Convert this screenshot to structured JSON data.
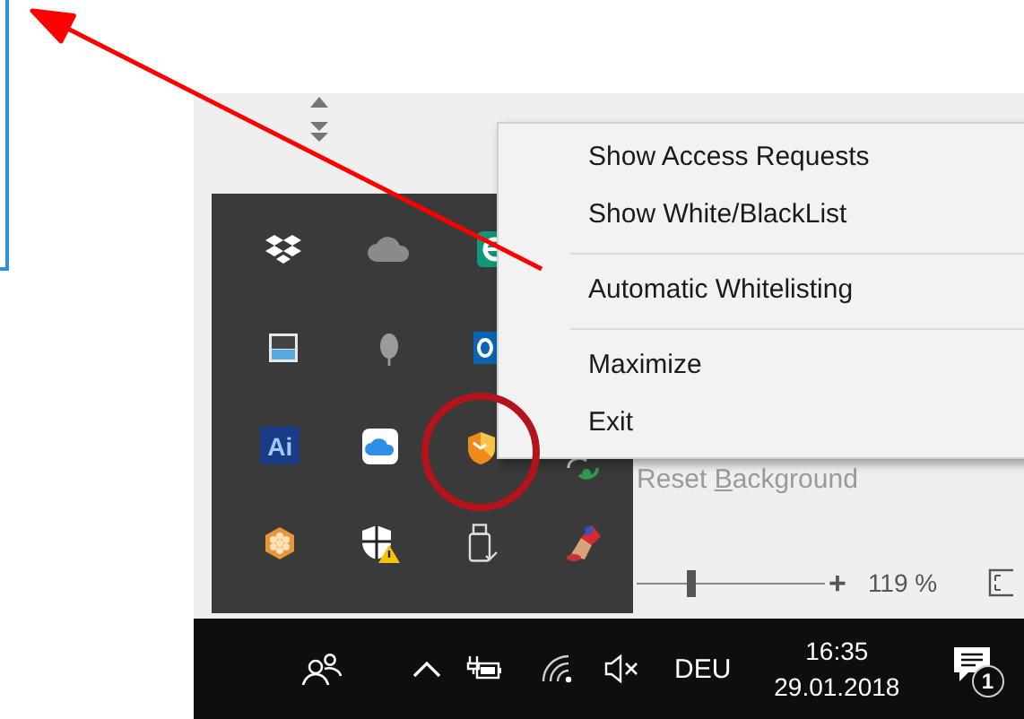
{
  "app": {
    "reset_button": {
      "label_parts": [
        {
          "text": "Reset ",
          "underlined": false
        },
        {
          "text": "B",
          "underlined": true
        },
        {
          "text": "ackground",
          "underlined": false
        }
      ]
    },
    "zoom": {
      "level": 0.29,
      "plus": "+",
      "percent": "119 %"
    }
  },
  "tray_overflow": {
    "rows": [
      [
        {
          "kind": "boxes"
        },
        {
          "kind": "cloud"
        },
        {
          "kind": "green_tile"
        }
      ],
      [
        {
          "kind": "window"
        },
        {
          "kind": "bug"
        },
        {
          "kind": "mail"
        }
      ],
      [
        {
          "kind": "tile",
          "label": "Ai"
        },
        {
          "kind": "cloud_tile"
        },
        {
          "kind": "shield"
        },
        {
          "kind": "sync"
        }
      ],
      [
        {
          "kind": "flower"
        },
        {
          "kind": "shield_warning"
        },
        {
          "kind": "usb"
        },
        {
          "kind": "paint"
        }
      ]
    ]
  },
  "context_menu": {
    "items": [
      {
        "kind": "item",
        "label": "Show Access Requests"
      },
      {
        "kind": "item",
        "label": "Show White/BlackList"
      },
      {
        "kind": "separator"
      },
      {
        "kind": "item",
        "label": "Automatic Whitelisting"
      },
      {
        "kind": "separator"
      },
      {
        "kind": "item",
        "label": "Maximize"
      },
      {
        "kind": "item",
        "label": "Exit"
      }
    ]
  },
  "taskbar": {
    "tray": [
      {
        "kind": "people"
      },
      {
        "kind": "chevron"
      },
      {
        "kind": "power"
      },
      {
        "kind": "wifi"
      },
      {
        "kind": "volume_muted"
      }
    ],
    "language": "DEU",
    "time": "16:35",
    "date": "29.01.2018",
    "notifications": {
      "count": "1"
    }
  }
}
